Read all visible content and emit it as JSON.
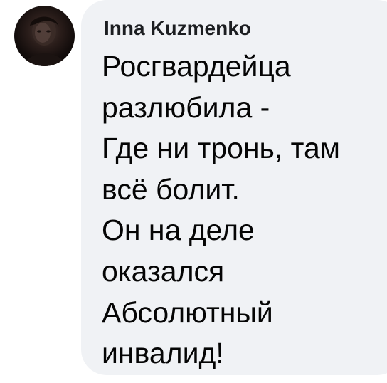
{
  "comment": {
    "author": "Inna Kuzmenko",
    "avatar_icon": "user-avatar-photo",
    "bubble_color": "#f0f2f5",
    "lines": [
      "Росгвардейца",
      "разлюбила -",
      "Где ни тронь, там",
      "всё болит.",
      "Он на деле",
      "оказался",
      "Абсолютный",
      "инвалид!"
    ]
  }
}
